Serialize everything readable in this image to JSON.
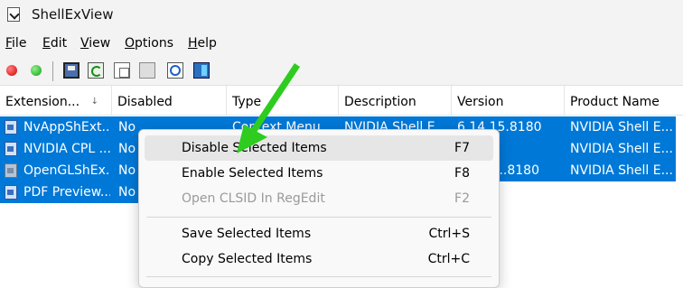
{
  "window": {
    "title": "ShellExView"
  },
  "menubar": [
    {
      "label": "File",
      "underline": "F",
      "rest": "ile"
    },
    {
      "label": "Edit",
      "underline": "E",
      "rest": "dit"
    },
    {
      "label": "View",
      "underline": "V",
      "rest": "iew"
    },
    {
      "label": "Options",
      "underline": "O",
      "rest": "ptions"
    },
    {
      "label": "Help",
      "underline": "H",
      "rest": "elp"
    }
  ],
  "toolbar": {
    "icons": [
      "disable-red-dot-icon",
      "enable-green-dot-icon",
      "save-icon",
      "refresh-icon",
      "copy-icon",
      "properties-icon",
      "find-icon",
      "exit-icon"
    ]
  },
  "columns": [
    {
      "label": "Extension...",
      "sort": "↓"
    },
    {
      "label": "Disabled"
    },
    {
      "label": "Type"
    },
    {
      "label": "Description"
    },
    {
      "label": "Version"
    },
    {
      "label": "Product Name"
    }
  ],
  "rows": [
    {
      "extension": "NvAppShExt...",
      "disabled": "No",
      "type": "Context Menu",
      "description": "NVIDIA Shell E...",
      "version": "6.14.15.8180",
      "product": "NVIDIA Shell E...",
      "icon": "extension-icon"
    },
    {
      "extension": "NVIDIA CPL ...",
      "disabled": "No",
      "type": "",
      "description": "",
      "version": "",
      "product": "NVIDIA Shell E...",
      "icon": "extension-icon"
    },
    {
      "extension": "OpenGLShEx...",
      "disabled": "No",
      "type": "",
      "description": "",
      "version": "...8180",
      "product": "NVIDIA Shell E...",
      "icon": "extension-grey-icon"
    },
    {
      "extension": "PDF Preview...",
      "disabled": "No",
      "type": "",
      "description": "",
      "version": "",
      "product": "",
      "icon": "extension-icon"
    }
  ],
  "context_menu": {
    "items": [
      {
        "label": "Disable Selected Items",
        "shortcut": "F7",
        "state": "hover"
      },
      {
        "label": "Enable Selected Items",
        "shortcut": "F8",
        "state": "normal"
      },
      {
        "label": "Open CLSID In RegEdit",
        "shortcut": "F2",
        "state": "disabled"
      },
      {
        "label": "Save Selected Items",
        "shortcut": "Ctrl+S",
        "state": "normal"
      },
      {
        "label": "Copy Selected Items",
        "shortcut": "Ctrl+C",
        "state": "normal"
      }
    ]
  },
  "colors": {
    "selection": "#0078d7",
    "annotation_arrow": "#2ecc1f"
  }
}
